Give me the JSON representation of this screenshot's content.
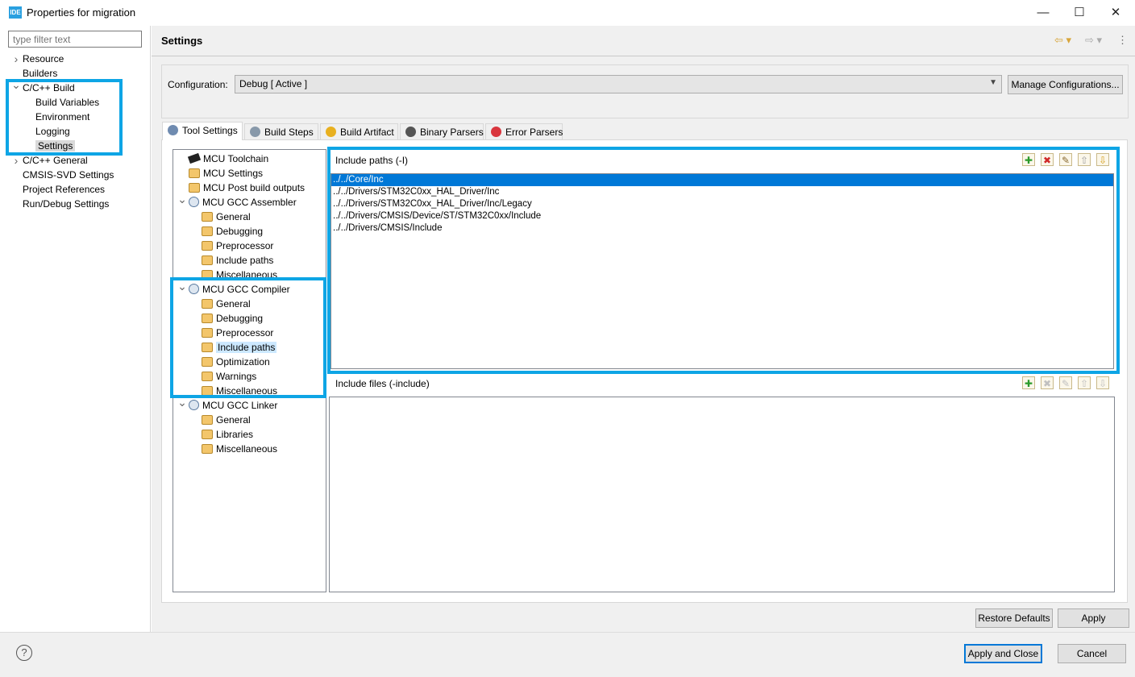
{
  "window": {
    "title": "Properties for migration",
    "app_icon": "IDE"
  },
  "left": {
    "filter_placeholder": "type filter text",
    "items": [
      {
        "label": "Resource",
        "level": 0,
        "chevron": "collapsed"
      },
      {
        "label": "Builders",
        "level": 0
      },
      {
        "label": "C/C++ Build",
        "level": 0,
        "chevron": "expanded"
      },
      {
        "label": "Build Variables",
        "level": 1
      },
      {
        "label": "Environment",
        "level": 1
      },
      {
        "label": "Logging",
        "level": 1
      },
      {
        "label": "Settings",
        "level": 1,
        "selected": true
      },
      {
        "label": "C/C++ General",
        "level": 0,
        "chevron": "collapsed"
      },
      {
        "label": "CMSIS-SVD Settings",
        "level": 0
      },
      {
        "label": "Project References",
        "level": 0
      },
      {
        "label": "Run/Debug Settings",
        "level": 0
      }
    ]
  },
  "header": {
    "title": "Settings"
  },
  "config": {
    "label": "Configuration:",
    "value": "Debug  [ Active ]",
    "manage_label": "Manage Configurations..."
  },
  "tabs": [
    {
      "label": "Tool Settings",
      "icon": "tool-settings-icon",
      "color": "#6f8bb0"
    },
    {
      "label": "Build Steps",
      "icon": "build-steps-icon",
      "color": "#8899aa"
    },
    {
      "label": "Build Artifact",
      "icon": "trophy-icon",
      "color": "#e8b020"
    },
    {
      "label": "Binary Parsers",
      "icon": "binary-icon",
      "color": "#555555"
    },
    {
      "label": "Error Parsers",
      "icon": "error-icon",
      "color": "#d9363e"
    }
  ],
  "tool_tree": [
    {
      "label": "MCU Toolchain",
      "level": 0,
      "icon": "chip"
    },
    {
      "label": "MCU Settings",
      "level": 0,
      "icon": "folder"
    },
    {
      "label": "MCU Post build outputs",
      "level": 0,
      "icon": "folder"
    },
    {
      "label": "MCU GCC Assembler",
      "level": 0,
      "icon": "gear",
      "chevron": true
    },
    {
      "label": "General",
      "level": 1,
      "icon": "folder"
    },
    {
      "label": "Debugging",
      "level": 1,
      "icon": "folder"
    },
    {
      "label": "Preprocessor",
      "level": 1,
      "icon": "folder"
    },
    {
      "label": "Include paths",
      "level": 1,
      "icon": "folder"
    },
    {
      "label": "Miscellaneous",
      "level": 1,
      "icon": "folder"
    },
    {
      "label": "MCU GCC Compiler",
      "level": 0,
      "icon": "gear",
      "chevron": true
    },
    {
      "label": "General",
      "level": 1,
      "icon": "folder"
    },
    {
      "label": "Debugging",
      "level": 1,
      "icon": "folder"
    },
    {
      "label": "Preprocessor",
      "level": 1,
      "icon": "folder"
    },
    {
      "label": "Include paths",
      "level": 1,
      "icon": "folder",
      "selected": true
    },
    {
      "label": "Optimization",
      "level": 1,
      "icon": "folder"
    },
    {
      "label": "Warnings",
      "level": 1,
      "icon": "folder"
    },
    {
      "label": "Miscellaneous",
      "level": 1,
      "icon": "folder"
    },
    {
      "label": "MCU GCC Linker",
      "level": 0,
      "icon": "gear",
      "chevron": true
    },
    {
      "label": "General",
      "level": 1,
      "icon": "folder"
    },
    {
      "label": "Libraries",
      "level": 1,
      "icon": "folder"
    },
    {
      "label": "Miscellaneous",
      "level": 1,
      "icon": "folder"
    }
  ],
  "include_paths": {
    "label": "Include paths (-I)",
    "items": [
      "../../Core/Inc",
      "../../Drivers/STM32C0xx_HAL_Driver/Inc",
      "../../Drivers/STM32C0xx_HAL_Driver/Inc/Legacy",
      "../../Drivers/CMSIS/Device/ST/STM32C0xx/Include",
      "../../Drivers/CMSIS/Include"
    ]
  },
  "include_files": {
    "label": "Include files (-include)",
    "items": []
  },
  "toolbar_icons": [
    {
      "name": "add-icon",
      "glyph": "✚",
      "color": "#2a9a2a"
    },
    {
      "name": "delete-icon",
      "glyph": "✖",
      "color": "#d02828"
    },
    {
      "name": "edit-icon",
      "glyph": "✎",
      "color": "#8a6a30"
    },
    {
      "name": "move-up-icon",
      "glyph": "⇧",
      "color": "#a0a0a0"
    },
    {
      "name": "move-down-icon",
      "glyph": "⇩",
      "color": "#d8a020"
    }
  ],
  "buttons": {
    "restore": "Restore Defaults",
    "apply": "Apply",
    "apply_close": "Apply and Close",
    "cancel": "Cancel"
  },
  "help": "?",
  "highlight_color": "#0ea5e5"
}
